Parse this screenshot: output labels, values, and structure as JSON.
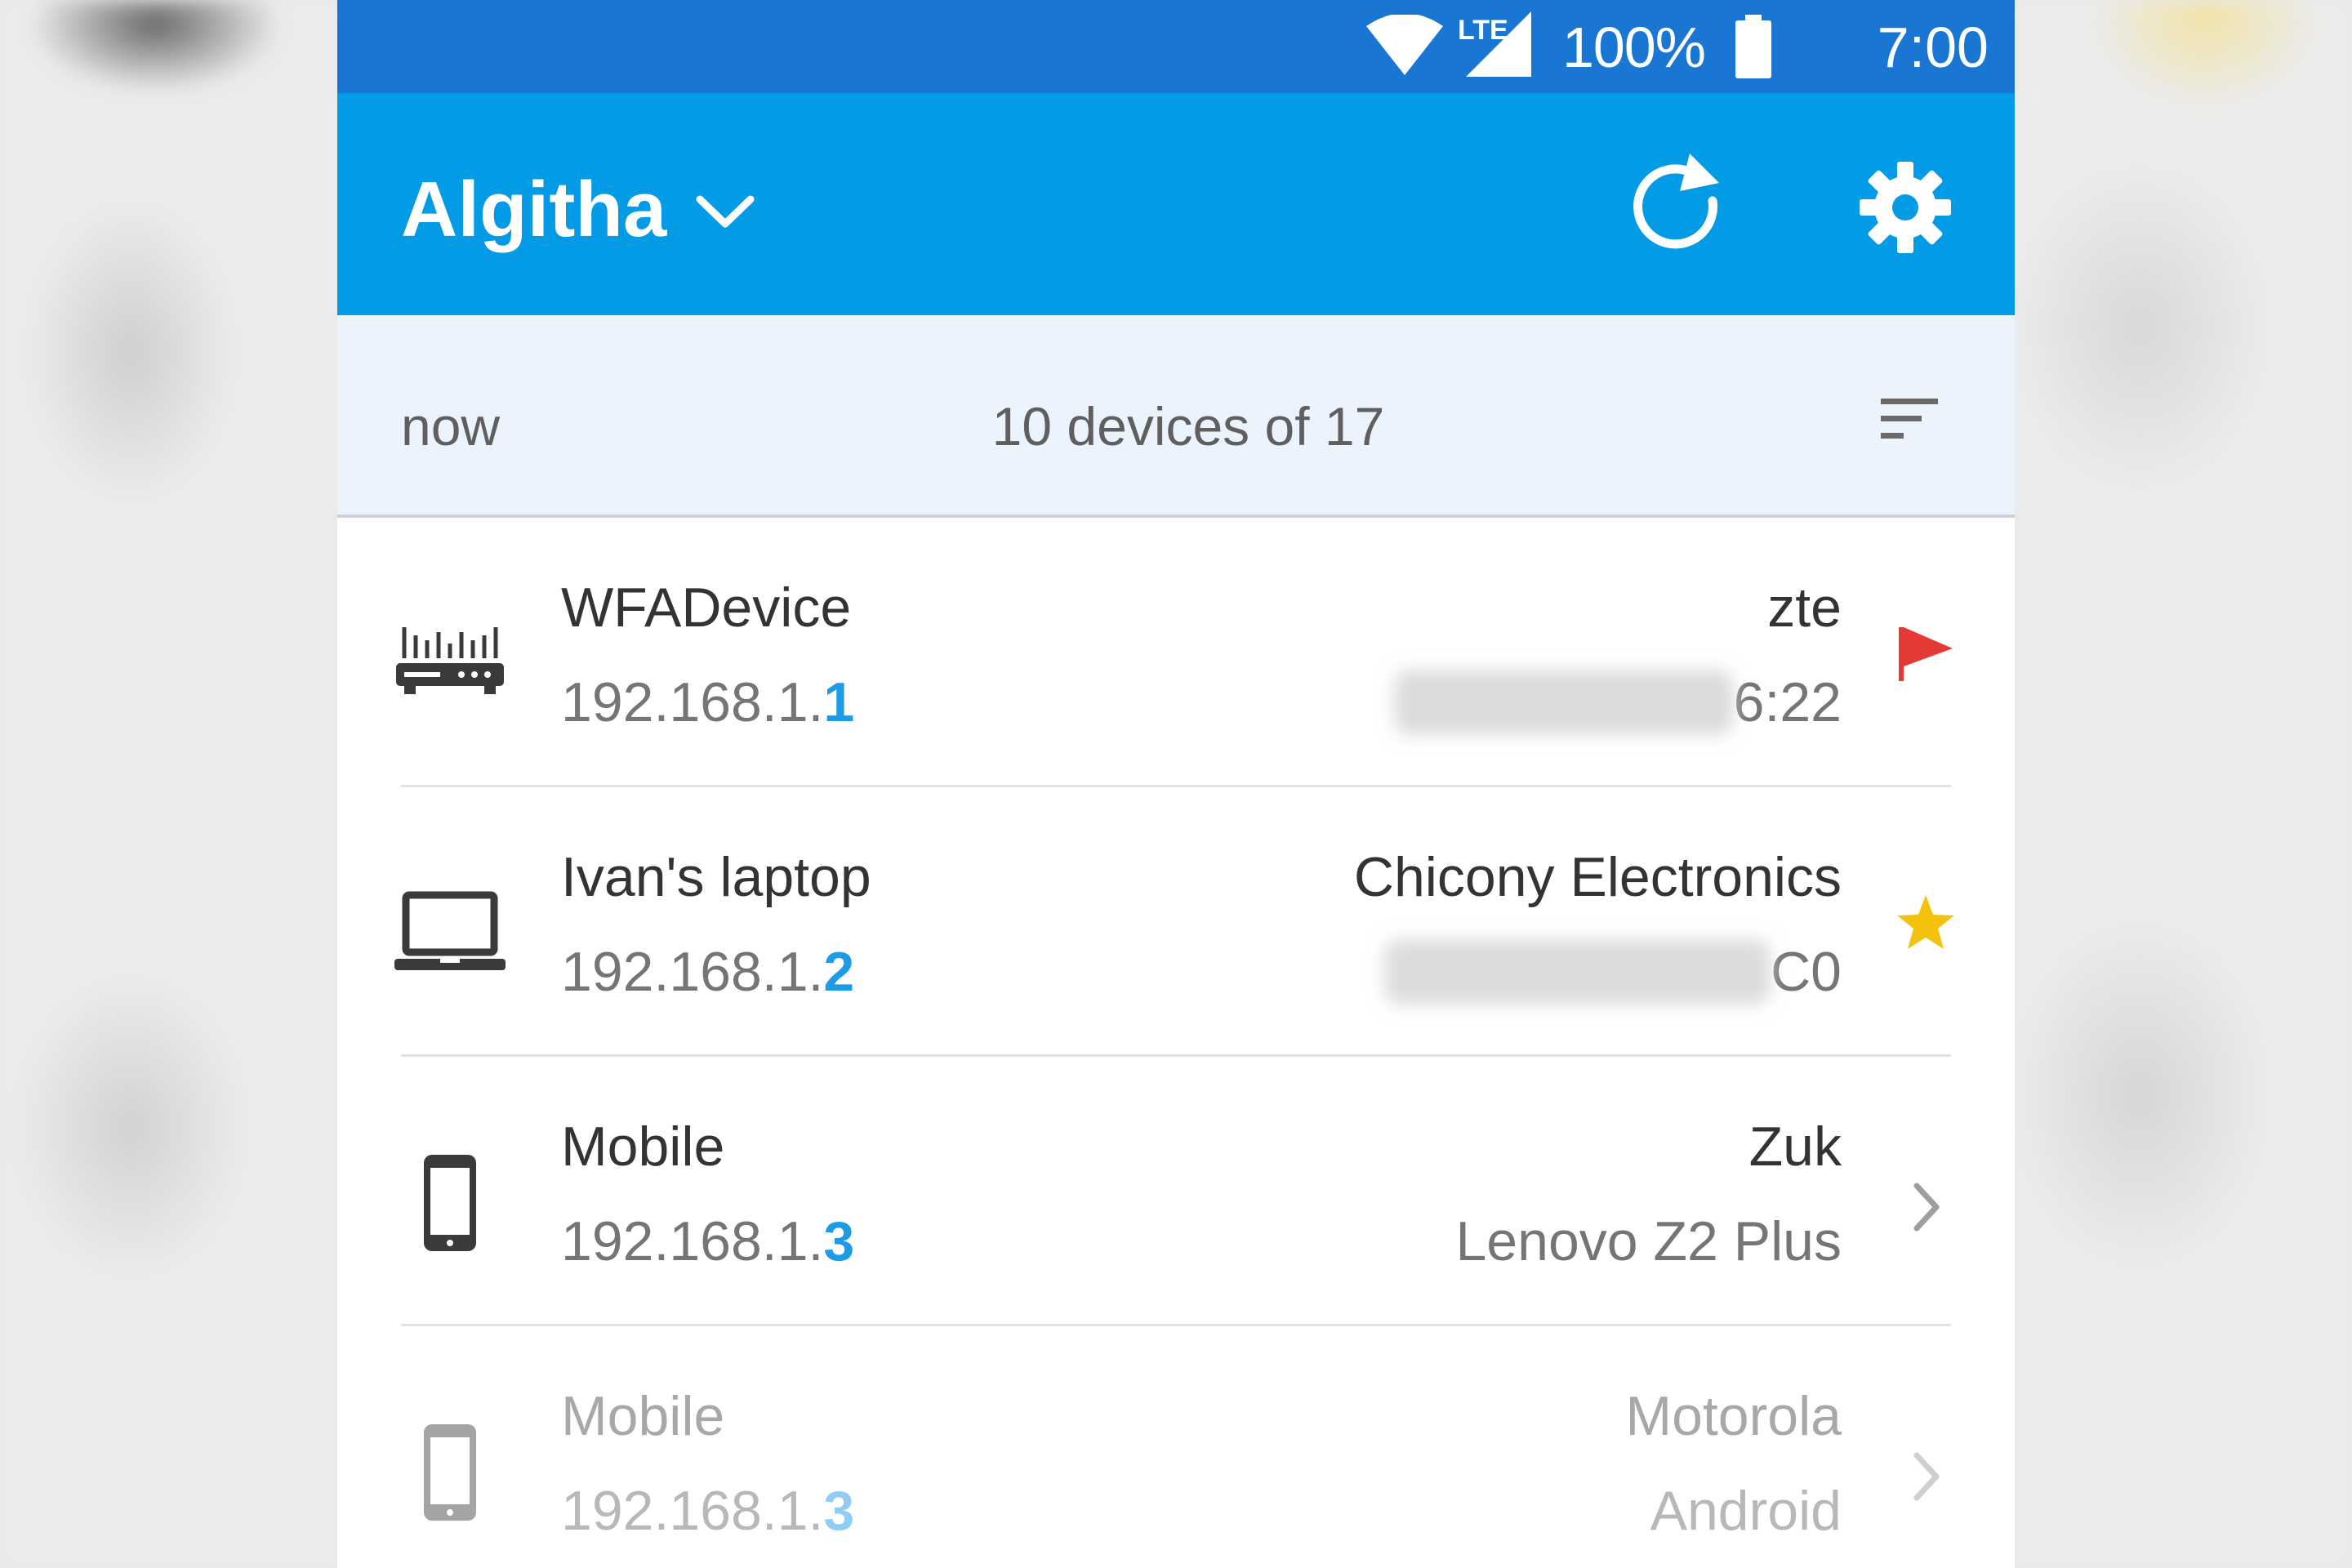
{
  "status_bar": {
    "network_type": "LTE",
    "battery_percent": "100%",
    "time": "7:00 PM",
    "icons": [
      "wifi-icon",
      "lte-signal-icon",
      "battery-icon"
    ]
  },
  "app_bar": {
    "network_name": "Algitha",
    "icons": [
      "chevron-down-icon",
      "refresh-icon",
      "gear-icon"
    ],
    "color": "#039be5"
  },
  "summary": {
    "scan_time": "now",
    "device_count": "10 devices of 17",
    "icons": [
      "sort-icon"
    ]
  },
  "colors": {
    "status_bar": "#1976d2",
    "ip_highlight": "#1e9be5",
    "flag": "#e53935",
    "star": "#f4c20d"
  },
  "devices": [
    {
      "name": "WFADevice",
      "ip_prefix": "192.168.1.",
      "ip_last": "1",
      "vendor": "zte",
      "detail": "6:22",
      "detail_blurred": true,
      "type_icon": "router-icon",
      "marker": "flag-icon",
      "dimmed": false
    },
    {
      "name": "Ivan's laptop",
      "ip_prefix": "192.168.1.",
      "ip_last": "2",
      "vendor": "Chicony Electronics",
      "detail": "C0",
      "detail_blurred": true,
      "type_icon": "laptop-icon",
      "marker": "star-icon",
      "dimmed": false
    },
    {
      "name": "Mobile",
      "ip_prefix": "192.168.1.",
      "ip_last": "3",
      "vendor": "Zuk",
      "detail": "Lenovo Z2 Plus",
      "detail_blurred": false,
      "type_icon": "smartphone-icon",
      "marker": "chevron-right-icon",
      "dimmed": false
    },
    {
      "name": "Mobile",
      "ip_prefix": "192.168.1.",
      "ip_last": "3",
      "vendor": "Motorola",
      "detail": "Android",
      "detail_blurred": false,
      "type_icon": "smartphone-icon",
      "marker": "chevron-right-icon",
      "dimmed": true
    }
  ]
}
